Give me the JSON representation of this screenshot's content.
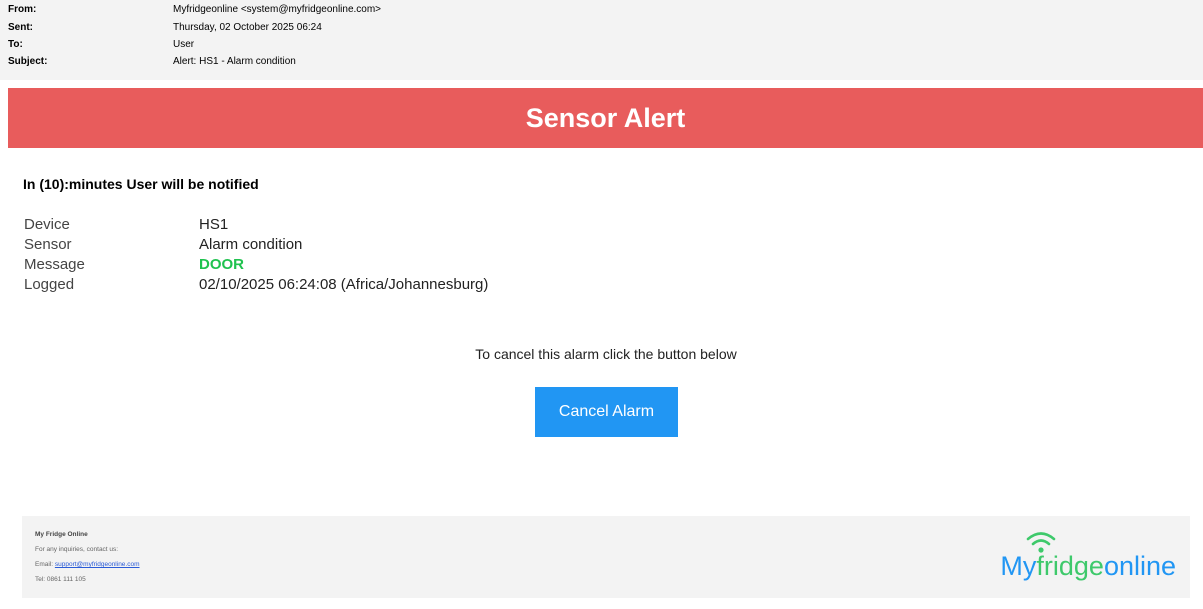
{
  "email": {
    "from_label": "From:",
    "from_value": "Myfridgeonline <system@myfridgeonline.com>",
    "sent_label": "Sent:",
    "sent_value": "Thursday, 02 October 2025 06:24",
    "to_label": "To:",
    "to_value": "User",
    "subject_label": "Subject:",
    "subject_value": "Alert: HS1 - Alarm condition"
  },
  "banner": {
    "title": "Sensor Alert",
    "color": "#e85c5c"
  },
  "notify_line": "In (10):minutes User will be notified",
  "details": {
    "device_label": "Device",
    "device_value": "HS1",
    "sensor_label": "Sensor",
    "sensor_value": "Alarm condition",
    "message_label": "Message",
    "message_value": "DOOR",
    "logged_label": "Logged",
    "logged_value": "02/10/2025 06:24:08 (Africa/Johannesburg)"
  },
  "cancel": {
    "instruction": "To cancel this alarm click the button below",
    "button_label": "Cancel Alarm",
    "button_color": "#2196f3"
  },
  "footer": {
    "company": "My Fridge Online",
    "contact_line": "For any inquiries, contact us:",
    "email_label": "Email:",
    "email_link": "support@myfridgeonline.com",
    "tel": "Tel: 0861 111 105",
    "logo_part1": "My",
    "logo_part2": "fridge",
    "logo_part3": "online",
    "logo_icon": "wifi-icon"
  }
}
